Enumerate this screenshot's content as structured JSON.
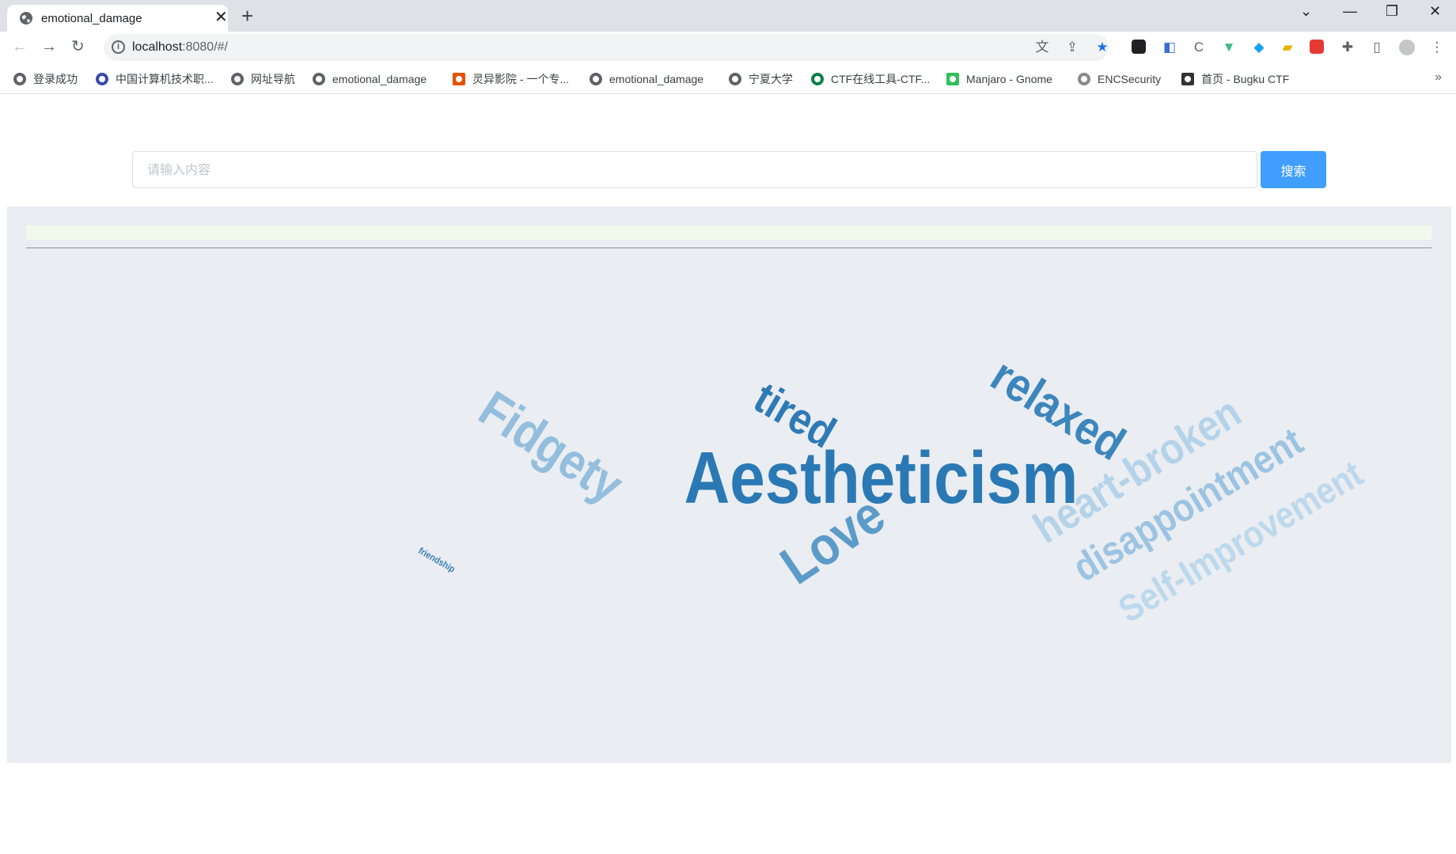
{
  "browser": {
    "tab": {
      "title": "emotional_damage",
      "close_glyph": "✕"
    },
    "new_tab_glyph": "+",
    "window_controls": {
      "dropdown": "⌄",
      "minimize": "—",
      "restore": "❐",
      "close": "✕"
    },
    "address": {
      "host": "localhost",
      "rest": ":8080/#/"
    },
    "bookmarks": [
      {
        "label": "登录成功"
      },
      {
        "label": "中国计算机技术职..."
      },
      {
        "label": "网址导航"
      },
      {
        "label": "emotional_damage"
      },
      {
        "label": "灵异影院 - 一个专..."
      },
      {
        "label": "emotional_damage"
      },
      {
        "label": "宁夏大学"
      },
      {
        "label": "CTF在线工具-CTF..."
      },
      {
        "label": "Manjaro - Gnome"
      },
      {
        "label": "ENCSecurity"
      },
      {
        "label": "首页 - Bugku CTF"
      }
    ],
    "bookmarks_more": "»"
  },
  "search": {
    "placeholder": "请输入内容",
    "button_label": "搜索"
  },
  "word_cloud": {
    "colors": {
      "dark": "#2b7bb9",
      "mid": "#4a90c2",
      "light": "#8fbadb",
      "pale": "#a9cde6",
      "paler": "#b7d4ea"
    },
    "words": [
      {
        "text": "Aestheticism",
        "color": "#2a79b5"
      },
      {
        "text": "tired",
        "color": "#2e7ab5"
      },
      {
        "text": "relaxed",
        "color": "#3d86bd"
      },
      {
        "text": "Fidgety",
        "color": "#93bedd"
      },
      {
        "text": "Love",
        "color": "#5b9bc9"
      },
      {
        "text": "heart-broken",
        "color": "#b4d3ea"
      },
      {
        "text": "disappointment",
        "color": "#9cc4e2"
      },
      {
        "text": "Self-Improvement",
        "color": "#bcd8ec"
      },
      {
        "text": "friendship",
        "color": "#3f7fb6"
      }
    ]
  }
}
